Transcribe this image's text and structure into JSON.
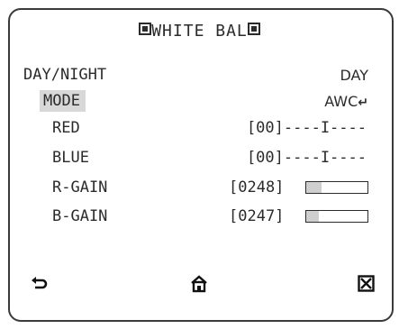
{
  "title": {
    "left_mark": "▣",
    "text": "WHITE BAL",
    "right_mark": "▣"
  },
  "rows": [
    {
      "label": "DAY/NIGHT",
      "value": "DAY"
    },
    {
      "label": "MODE",
      "value": "AWC",
      "value_icon": "enter-icon"
    },
    {
      "label": "RED",
      "value": "[00]----I----"
    },
    {
      "label": "BLUE",
      "value": "[00]----I----"
    },
    {
      "label": "R-GAIN",
      "value": "[0248]",
      "level": 0.25
    },
    {
      "label": "B-GAIN",
      "value": "[0247]",
      "level": 0.2
    }
  ],
  "nav": {
    "back": "back-arrow-icon",
    "home": "home-icon",
    "exit": "close-box-icon"
  }
}
